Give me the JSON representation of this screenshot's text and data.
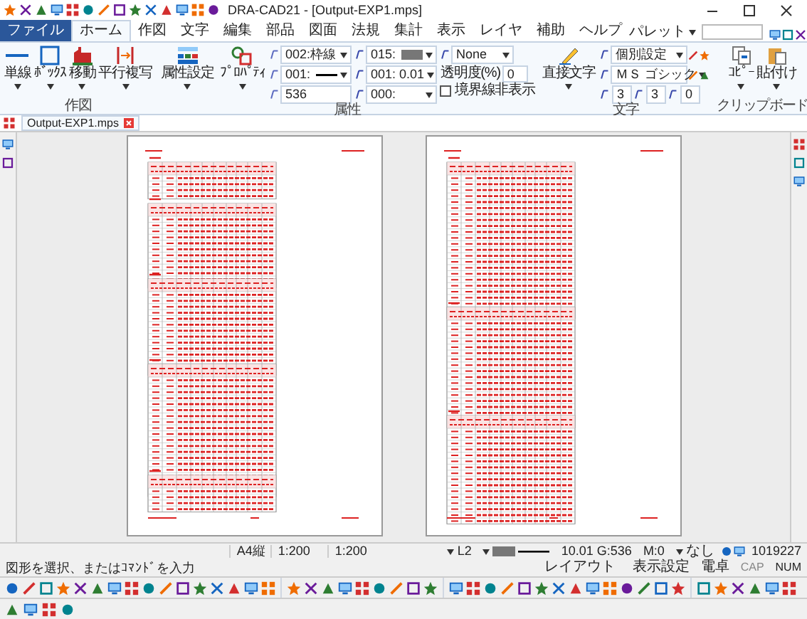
{
  "window": {
    "title": "DRA-CAD21 - [Output-EXP1.mps]"
  },
  "menu_tabs": [
    {
      "label": "ファイル",
      "kind": "file",
      "selected": false
    },
    {
      "label": "ホーム",
      "kind": "tab",
      "selected": true
    },
    {
      "label": "作図",
      "kind": "tab",
      "selected": false
    },
    {
      "label": "文字",
      "kind": "tab",
      "selected": false
    },
    {
      "label": "編集",
      "kind": "tab",
      "selected": false
    },
    {
      "label": "部品",
      "kind": "tab",
      "selected": false
    },
    {
      "label": "図面",
      "kind": "tab",
      "selected": false
    },
    {
      "label": "法規",
      "kind": "tab",
      "selected": false
    },
    {
      "label": "集計",
      "kind": "tab",
      "selected": false
    },
    {
      "label": "表示",
      "kind": "tab",
      "selected": false
    },
    {
      "label": "レイヤ",
      "kind": "tab",
      "selected": false
    },
    {
      "label": "補助",
      "kind": "tab",
      "selected": false
    },
    {
      "label": "ヘルプ",
      "kind": "tab",
      "selected": false
    }
  ],
  "palette": {
    "label": "パレット"
  },
  "ribbon": {
    "draw_group": {
      "label": "作図",
      "buttons": [
        "単線",
        "ﾎﾞｯｸｽ",
        "移動",
        "平行複写"
      ]
    },
    "attr_group": {
      "label": "属性",
      "buttons": [
        "属性設定",
        "ﾌﾟﾛﾊﾟﾃｨ"
      ],
      "fields": [
        {
          "value": "002:枠線",
          "kind": "combo"
        },
        {
          "value": "001:",
          "kind": "line"
        },
        {
          "value": "536",
          "kind": "text"
        },
        {
          "value": "015:",
          "kind": "swatch"
        },
        {
          "value": "001: 0.01",
          "kind": "combo"
        },
        {
          "value": "000:",
          "kind": "combo"
        },
        {
          "value": "None",
          "kind": "combo"
        }
      ],
      "transparency": {
        "label": "透明度(%)",
        "value": "0"
      },
      "hide_border": {
        "label": "境界線非表示",
        "checked": false
      }
    },
    "text_group": {
      "label": "文字",
      "button": "直接文字",
      "fields": [
        {
          "value": "個別設定",
          "kind": "combo"
        },
        {
          "value": "ＭＳ ゴシック",
          "kind": "combo"
        },
        {
          "value": "3",
          "kind": "text"
        },
        {
          "value": "3",
          "kind": "text"
        },
        {
          "value": "0",
          "kind": "text"
        }
      ]
    },
    "clipboard_group": {
      "label": "クリップボード",
      "buttons": [
        "ｺﾋﾟｰ",
        "貼付け"
      ]
    }
  },
  "doc_tab": {
    "label": "Output-EXP1.mps"
  },
  "status": {
    "paper": "A4縦",
    "scale_1": "1:200",
    "scale_2": "1:200",
    "layer": "L2",
    "readout": "10.01 G:536",
    "m": "M:0",
    "none": "なし",
    "count": "1019227",
    "prompt": "図形を選択、またはｺﾏﾝﾄﾞを入力",
    "layout": "レイアウト",
    "display": "表示設定",
    "calc": "電卓",
    "cap": "CAP",
    "num": "NUM"
  }
}
